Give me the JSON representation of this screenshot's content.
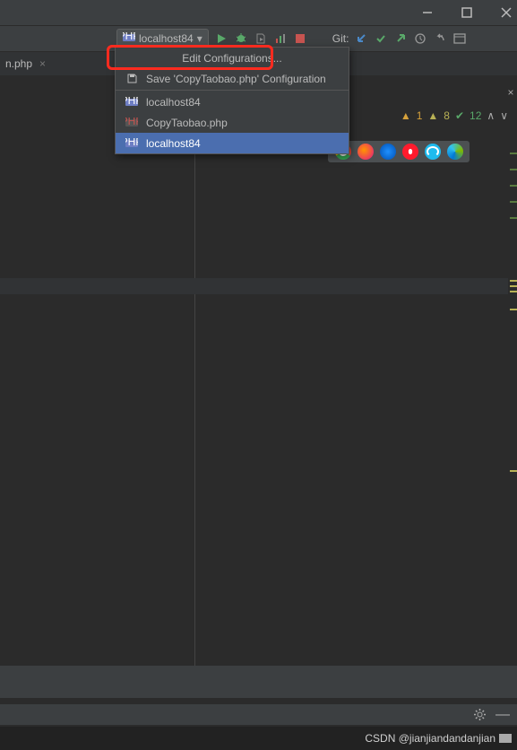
{
  "window": {
    "title": ""
  },
  "toolbar": {
    "config_selected": "localhost84",
    "git_label": "Git:"
  },
  "tabs": {
    "open_file": "n.php"
  },
  "dropdown": {
    "edit": "Edit Configurations...",
    "save": "Save 'CopyTaobao.php' Configuration",
    "items": [
      {
        "label": "localhost84",
        "kind": "php"
      },
      {
        "label": "CopyTaobao.php",
        "kind": "phpx"
      },
      {
        "label": "localhost84",
        "kind": "php",
        "selected": true
      }
    ]
  },
  "inspections": {
    "warn1": "1",
    "warn2": "8",
    "check": "12"
  },
  "footer": {
    "watermark": "CSDN @jianjiandandanjian"
  },
  "icons": {
    "minimize": "minimize-icon",
    "maximize": "maximize-icon",
    "close": "close-icon",
    "run": "run-icon",
    "debug": "debug-icon",
    "coverage": "coverage-icon",
    "profile": "profile-icon",
    "stop": "stop-icon",
    "git_down": "git-pull-icon",
    "git_commit": "git-commit-icon",
    "git_push": "git-push-icon",
    "history": "history-icon",
    "undo": "undo-icon",
    "more": "more-icon",
    "save": "save-icon",
    "php": "php-icon",
    "settings": "settings-icon",
    "chrome": "chrome-icon",
    "firefox": "firefox-icon",
    "safari": "safari-icon",
    "opera": "opera-icon",
    "ie": "ie-icon",
    "edge": "edge-icon"
  }
}
